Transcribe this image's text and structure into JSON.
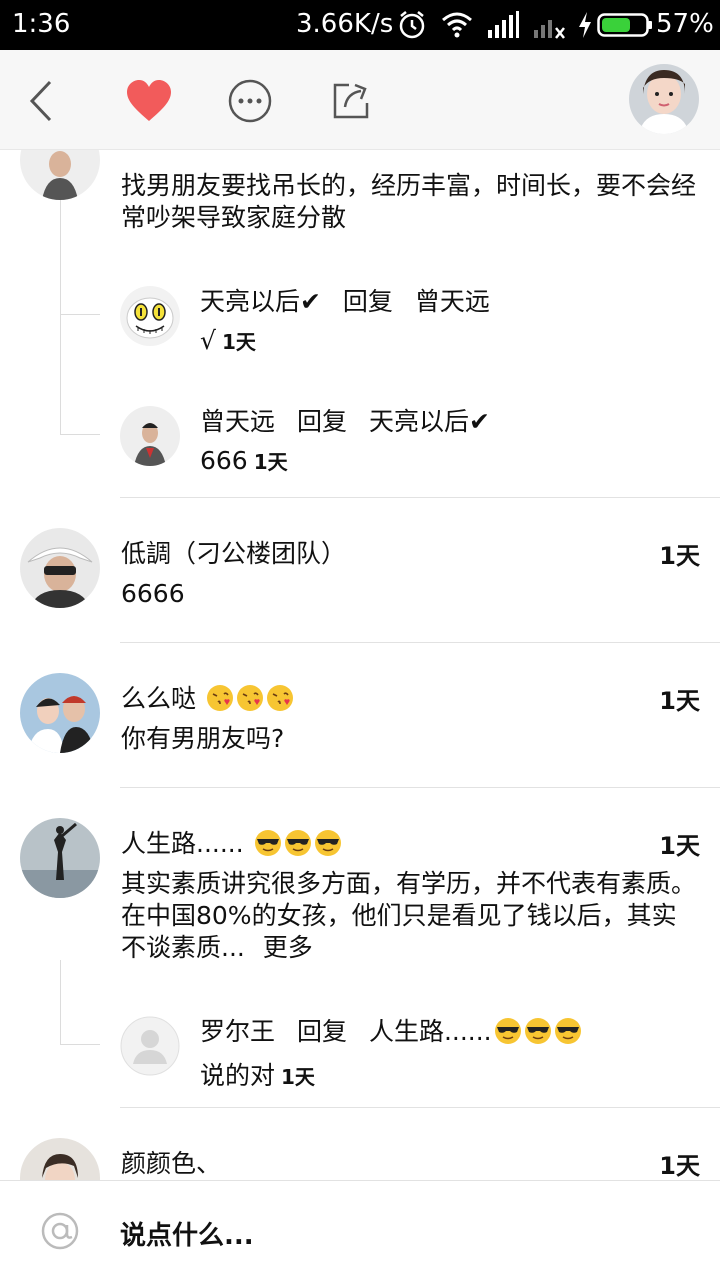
{
  "status_bar": {
    "time": "1:36",
    "net_speed": "3.66K/s",
    "battery": "57%",
    "icons": [
      "alarm-icon",
      "wifi-icon",
      "signal-icon",
      "signal-x-icon",
      "charging-icon",
      "battery-icon"
    ]
  },
  "toolbar": {
    "icons": [
      "back-icon",
      "heart-icon",
      "more-icon",
      "share-icon"
    ],
    "accent_color": "#f25b5b"
  },
  "comments_top": {
    "text": "找男朋友要找吊长的，经历丰富，时间长，要不会经常吵架导致家庭分散",
    "replies": [
      {
        "name": "天亮以后✔",
        "reply_word": "回复",
        "target": "曾天远",
        "body": "√",
        "time": "1天"
      },
      {
        "name": "曾天远",
        "reply_word": "回复",
        "target": "天亮以后✔",
        "body": "666",
        "time": "1天"
      }
    ]
  },
  "comments": [
    {
      "name": "低調（刁公楼团队）",
      "time": "1天",
      "text": "6666"
    },
    {
      "name": "么么哒",
      "time": "1天",
      "text": "你有男朋友吗?"
    },
    {
      "name": "人生路......",
      "time": "1天",
      "text": "其实素质讲究很多方面，有学历，并不代表有素质。在中国80%的女孩，他们只是看见了钱以后，其实不谈素质...",
      "more": "更多",
      "reply": {
        "name": "罗尔王",
        "reply_word": "回复",
        "target": "人生路......",
        "body": "说的对",
        "time": "1天"
      }
    },
    {
      "name": "颜颜色、",
      "time": "1天"
    }
  ],
  "input": {
    "placeholder": "说点什么..."
  }
}
